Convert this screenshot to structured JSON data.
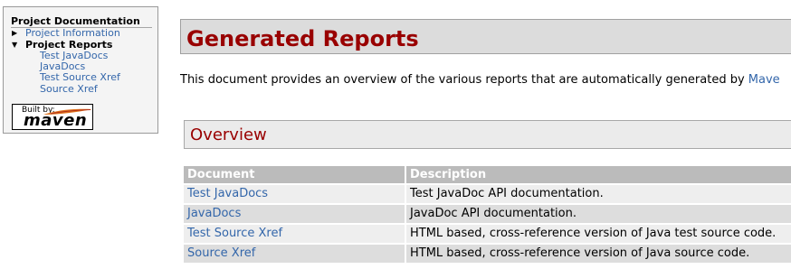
{
  "nav": {
    "title": "Project Documentation",
    "items": [
      {
        "label": "Project Information",
        "arrow": "▶"
      },
      {
        "label": "Project Reports",
        "arrow": "▼"
      }
    ],
    "subitems": [
      "Test JavaDocs",
      "JavaDocs",
      "Test Source Xref",
      "Source Xref"
    ],
    "badge": {
      "small": "Built by:",
      "big": "maven"
    }
  },
  "main": {
    "title": "Generated Reports",
    "intro_text": "This document provides an overview of the various reports that are automatically generated by ",
    "intro_link": "Mave",
    "section_title": "Overview",
    "table": {
      "headers": [
        "Document",
        "Description"
      ],
      "rows": [
        {
          "document": "Test JavaDocs",
          "description": "Test JavaDoc API documentation."
        },
        {
          "document": "JavaDocs",
          "description": "JavaDoc API documentation."
        },
        {
          "document": "Test Source Xref",
          "description": "HTML based, cross-reference version of Java test source code."
        },
        {
          "document": "Source Xref",
          "description": "HTML based, cross-reference version of Java source code."
        }
      ]
    }
  },
  "colors": {
    "heading": "#990000",
    "link": "#3366aa",
    "table_header": "#bbbbbb"
  }
}
